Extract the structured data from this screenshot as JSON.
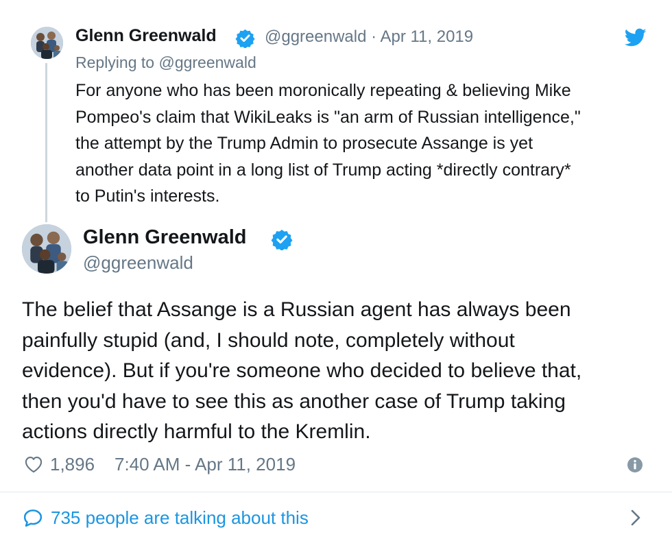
{
  "reply_tweet": {
    "author_name": "Glenn Greenwald",
    "verified_icon": "verified-badge-icon",
    "meta": "@ggreenwald · Apr 11, 2019",
    "replying_prefix": "Replying to",
    "replying_handle": "@ggreenwald",
    "body_lines": [
      "For anyone who has been moronically repeating & believing Mike",
      "Pompeo's claim that WikiLeaks is \"an arm of Russian intelligence,\"",
      "the attempt by the Trump Admin to prosecute Assange is yet",
      "another data point in a long list of Trump acting *directly contrary*",
      "to Putin's interests."
    ],
    "brand_icon": "twitter-bird-icon"
  },
  "main_tweet": {
    "author_name": "Glenn Greenwald",
    "handle": "@ggreenwald",
    "body_lines": [
      "The belief that Assange is a Russian agent has always been",
      "painfully stupid (and, I should note, completely without",
      "evidence). But if you're someone who decided to believe that,",
      "then you'd have to see this as another case of Trump taking",
      "actions directly harmful to the Kremlin."
    ],
    "like_count": "1,896",
    "timestamp": "7:40 AM - Apr 11, 2019"
  },
  "footer": {
    "talking_text": "735 people are talking about this"
  },
  "colors": {
    "text": "#14171a",
    "muted": "#657786",
    "brand_blue": "#1da1f2",
    "link_blue": "#1b95e0",
    "divider": "#e1e8ed",
    "thread_line": "#cdd6dd"
  }
}
